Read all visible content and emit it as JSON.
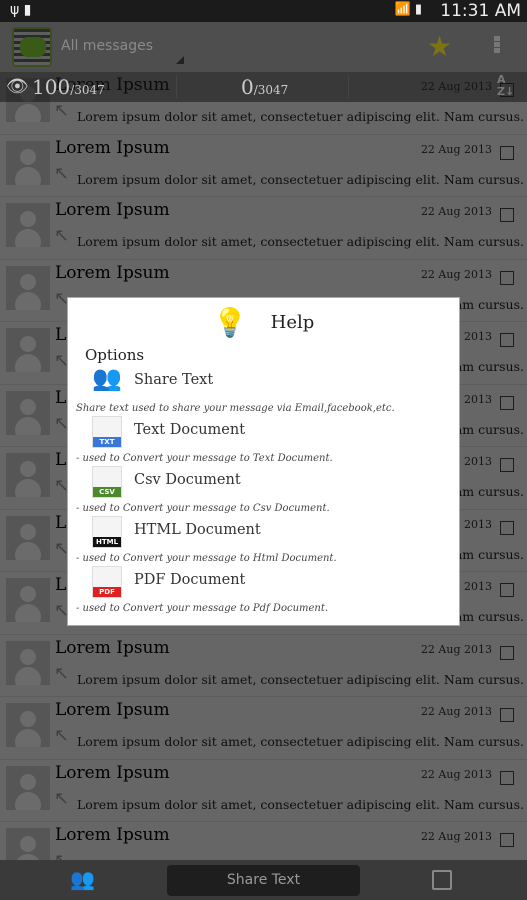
{
  "status_bar": {
    "time": "11:31 AM",
    "left_icons": [
      "usb-icon",
      "sim-icon"
    ],
    "right_icons": [
      "wifi-icon",
      "signal-icon",
      "battery-icon"
    ]
  },
  "action_bar": {
    "spinner": "All messages",
    "icons": [
      "app-logo",
      "star-icon",
      "overflow-menu-icon"
    ]
  },
  "counter_bar": {
    "viewed": "100",
    "viewed_total": "/3047",
    "selected": "0",
    "selected_total": "/3047",
    "sort_label": "A\nZ"
  },
  "messages": [
    {
      "title": "Lorem Ipsum",
      "date": "22 Aug 2013",
      "body": "Lorem ipsum dolor sit amet, consectetuer adipiscing elit. Nam cursus."
    },
    {
      "title": "Lorem Ipsum",
      "date": "22 Aug 2013",
      "body": "Lorem ipsum dolor sit amet, consectetuer adipiscing elit. Nam cursus."
    },
    {
      "title": "Lorem Ipsum",
      "date": "22 Aug 2013",
      "body": "Lorem ipsum dolor sit amet, consectetuer adipiscing elit. Nam cursus."
    },
    {
      "title": "Lorem Ipsum",
      "date": "22 Aug 2013",
      "body": "Lorem ipsum dolor sit amet, consectetuer adipiscing elit. Nam cursus."
    },
    {
      "title": "Lorem Ipsum",
      "date": "22 Aug 2013",
      "body": "Lorem ipsum dolor sit amet, consectetuer adipiscing elit. Nam cursus."
    },
    {
      "title": "Lorem Ipsum",
      "date": "22 Aug 2013",
      "body": "Lorem ipsum dolor sit amet, consectetuer adipiscing elit. Nam cursus."
    },
    {
      "title": "Lorem Ipsum",
      "date": "22 Aug 2013",
      "body": "Lorem ipsum dolor sit amet, consectetuer adipiscing elit. Nam cursus."
    },
    {
      "title": "Lorem Ipsum",
      "date": "22 Aug 2013",
      "body": "Lorem ipsum dolor sit amet, consectetuer adipiscing elit. Nam cursus."
    },
    {
      "title": "Lorem Ipsum",
      "date": "22 Aug 2013",
      "body": "Lorem ipsum dolor sit amet, consectetuer adipiscing elit. Nam cursus."
    },
    {
      "title": "Lorem Ipsum",
      "date": "22 Aug 2013",
      "body": "Lorem ipsum dolor sit amet, consectetuer adipiscing elit. Nam cursus."
    },
    {
      "title": "Lorem Ipsum",
      "date": "22 Aug 2013",
      "body": "Lorem ipsum dolor sit amet, consectetuer adipiscing elit. Nam cursus."
    },
    {
      "title": "Lorem Ipsum",
      "date": "22 Aug 2013",
      "body": "Lorem ipsum dolor sit amet, consectetuer adipiscing elit. Nam cursus."
    },
    {
      "title": "Lorem Ipsum",
      "date": "22 Aug 2013",
      "body": "Lorem ipsum dolor sit amet, consectetuer adipiscing elit. Nam cursus."
    }
  ],
  "dialog": {
    "title": "Help",
    "section": "Options",
    "options": [
      {
        "label": "Share Text",
        "desc": "Share text used to share your message via Email,facebook,etc.",
        "icon": "share-people-icon",
        "badge": ""
      },
      {
        "label": "Text Document",
        "desc": "- used to Convert your message to Text Document.",
        "icon": "txt-file-icon",
        "badge": "TXT",
        "color": "#3a78d8"
      },
      {
        "label": "Csv Document",
        "desc": "- used to Convert your message to Csv Document.",
        "icon": "csv-file-icon",
        "badge": "CSV",
        "color": "#4a8a2a"
      },
      {
        "label": "HTML Document",
        "desc": "- used to Convert your message to Html Document.",
        "icon": "html-file-icon",
        "badge": "HTML",
        "color": "#111111"
      },
      {
        "label": "PDF Document",
        "desc": "- used to Convert your message to Pdf Document.",
        "icon": "pdf-file-icon",
        "badge": "PDF",
        "color": "#e02020"
      }
    ]
  },
  "bottom_bar": {
    "share_button": "Share Text"
  }
}
